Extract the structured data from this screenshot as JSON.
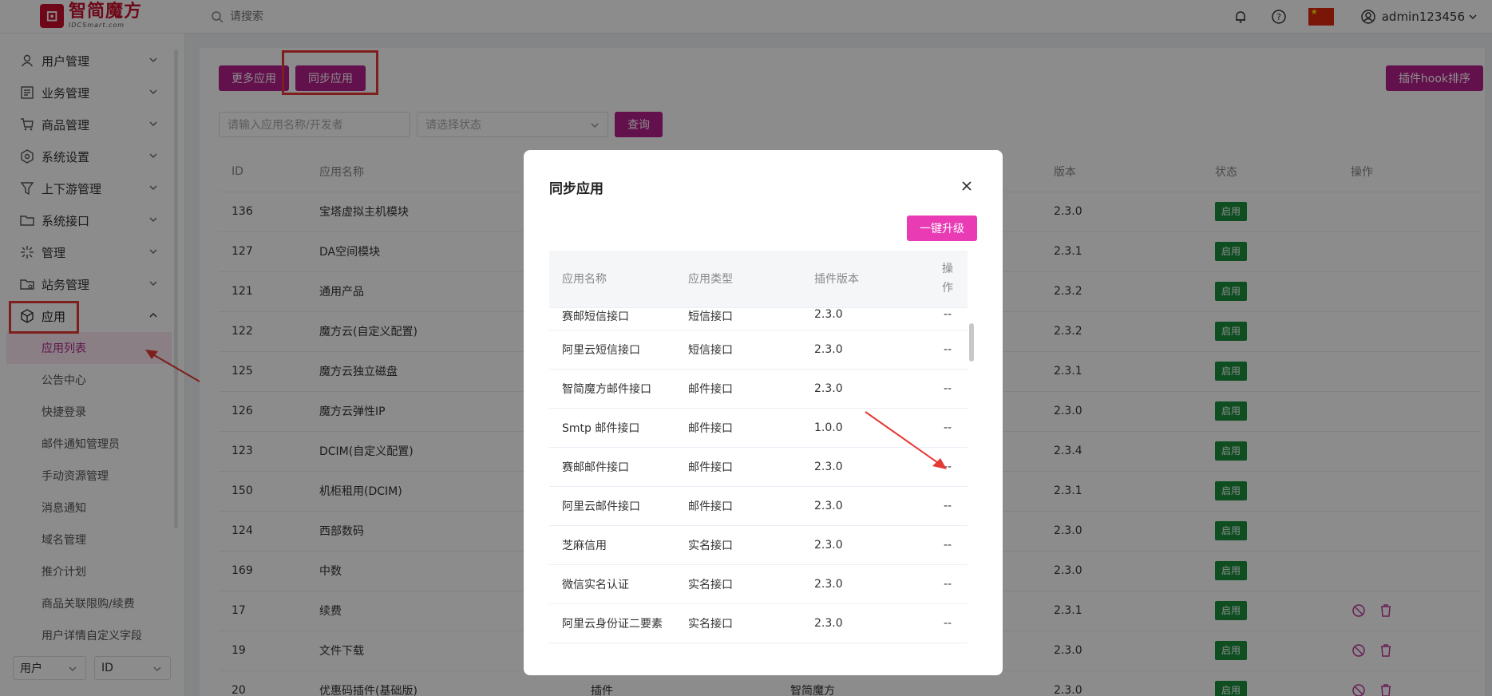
{
  "brand": {
    "logo_cn": "智简魔方",
    "logo_en": "IDCSmart.com"
  },
  "topbar": {
    "search_placeholder": "请搜索",
    "username": "admin123456"
  },
  "colors": {
    "primary": "#b5208d",
    "upgrade": "#e83bb4",
    "status_green": "#1a8f3c",
    "highlight": "#e53935"
  },
  "sidebar": {
    "menu": [
      {
        "label": "用户管理",
        "icon": "user-icon"
      },
      {
        "label": "业务管理",
        "icon": "list-icon"
      },
      {
        "label": "商品管理",
        "icon": "cart-icon"
      },
      {
        "label": "系统设置",
        "icon": "gear-icon"
      },
      {
        "label": "上下游管理",
        "icon": "filter-icon"
      },
      {
        "label": "系统接口",
        "icon": "folder-icon"
      },
      {
        "label": "管理",
        "icon": "spark-icon"
      },
      {
        "label": "站务管理",
        "icon": "folder-gear-icon"
      },
      {
        "label": "应用",
        "icon": "box-icon"
      }
    ],
    "sub_items": [
      "应用列表",
      "公告中心",
      "快捷登录",
      "邮件通知管理员",
      "手动资源管理",
      "消息通知",
      "域名管理",
      "推介计划",
      "商品关联限购/续费",
      "用户详情自定义字段"
    ],
    "bottom_select_1": "用户",
    "bottom_select_2": "ID"
  },
  "main": {
    "btn_more": "更多应用",
    "btn_sync": "同步应用",
    "btn_hook": "插件hook排序",
    "search_placeholder": "请输入应用名称/开发者",
    "status_placeholder": "请选择状态",
    "btn_query": "查询",
    "columns": {
      "id": "ID",
      "name": "应用名称",
      "version": "版本",
      "status": "状态",
      "ops": "操作"
    },
    "rows": [
      {
        "id": "136",
        "name": "宝塔虚拟主机模块",
        "version": "2.3.0",
        "status": "启用"
      },
      {
        "id": "127",
        "name": "DA空间模块",
        "version": "2.3.1",
        "status": "启用"
      },
      {
        "id": "121",
        "name": "通用产品",
        "version": "2.3.2",
        "status": "启用"
      },
      {
        "id": "122",
        "name": "魔方云(自定义配置)",
        "version": "2.3.2",
        "status": "启用"
      },
      {
        "id": "125",
        "name": "魔方云独立磁盘",
        "version": "2.3.1",
        "status": "启用"
      },
      {
        "id": "126",
        "name": "魔方云弹性IP",
        "version": "2.3.0",
        "status": "启用"
      },
      {
        "id": "123",
        "name": "DCIM(自定义配置)",
        "version": "2.3.4",
        "status": "启用"
      },
      {
        "id": "150",
        "name": "机柜租用(DCIM)",
        "version": "2.3.1",
        "status": "启用"
      },
      {
        "id": "124",
        "name": "西部数码",
        "version": "2.3.0",
        "status": "启用"
      },
      {
        "id": "169",
        "name": "中数",
        "version": "2.3.0",
        "status": "启用"
      },
      {
        "id": "17",
        "name": "续费",
        "version": "2.3.1",
        "status": "启用"
      },
      {
        "id": "19",
        "name": "文件下载",
        "version": "2.3.0",
        "status": "启用"
      },
      {
        "id": "20",
        "name": "优惠码插件(基础版)",
        "type": "插件",
        "dev": "智简魔方",
        "version": "2.3.0",
        "status": "启用"
      }
    ]
  },
  "modal": {
    "title": "同步应用",
    "btn_upgrade": "一键升级",
    "columns": {
      "name": "应用名称",
      "type": "应用类型",
      "version": "插件版本",
      "ops": "操作"
    },
    "rows": [
      {
        "name": "赛邮短信接口",
        "type": "短信接口",
        "version": "2.3.0",
        "op": "--"
      },
      {
        "name": "阿里云短信接口",
        "type": "短信接口",
        "version": "2.3.0",
        "op": "--"
      },
      {
        "name": "智简魔方邮件接口",
        "type": "邮件接口",
        "version": "2.3.0",
        "op": "--"
      },
      {
        "name": "Smtp 邮件接口",
        "type": "邮件接口",
        "version": "1.0.0",
        "op": "--"
      },
      {
        "name": "赛邮邮件接口",
        "type": "邮件接口",
        "version": "2.3.0",
        "op": "--"
      },
      {
        "name": "阿里云邮件接口",
        "type": "邮件接口",
        "version": "2.3.0",
        "op": "--"
      },
      {
        "name": "芝麻信用",
        "type": "实名接口",
        "version": "2.3.0",
        "op": "--"
      },
      {
        "name": "微信实名认证",
        "type": "实名接口",
        "version": "2.3.0",
        "op": "--"
      },
      {
        "name": "阿里云身份证二要素",
        "type": "实名接口",
        "version": "2.3.0",
        "op": "--"
      }
    ]
  }
}
